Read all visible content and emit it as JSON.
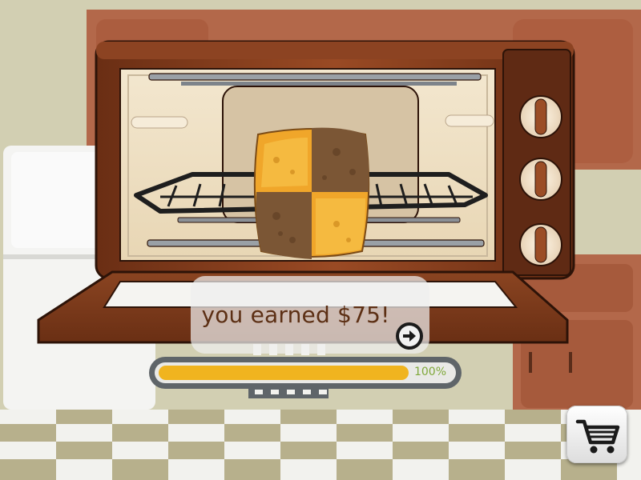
{
  "reward": {
    "message": "you earned $75!"
  },
  "progress": {
    "percent": 100,
    "label": "100%"
  },
  "colors": {
    "progress_fill": "#f0b41f",
    "progress_label": "#7fa83a",
    "oven_body": "#7a3a1c",
    "text": "#5c2f14"
  },
  "icons": {
    "next": "arrow-right-icon",
    "cart": "shopping-cart-icon"
  }
}
